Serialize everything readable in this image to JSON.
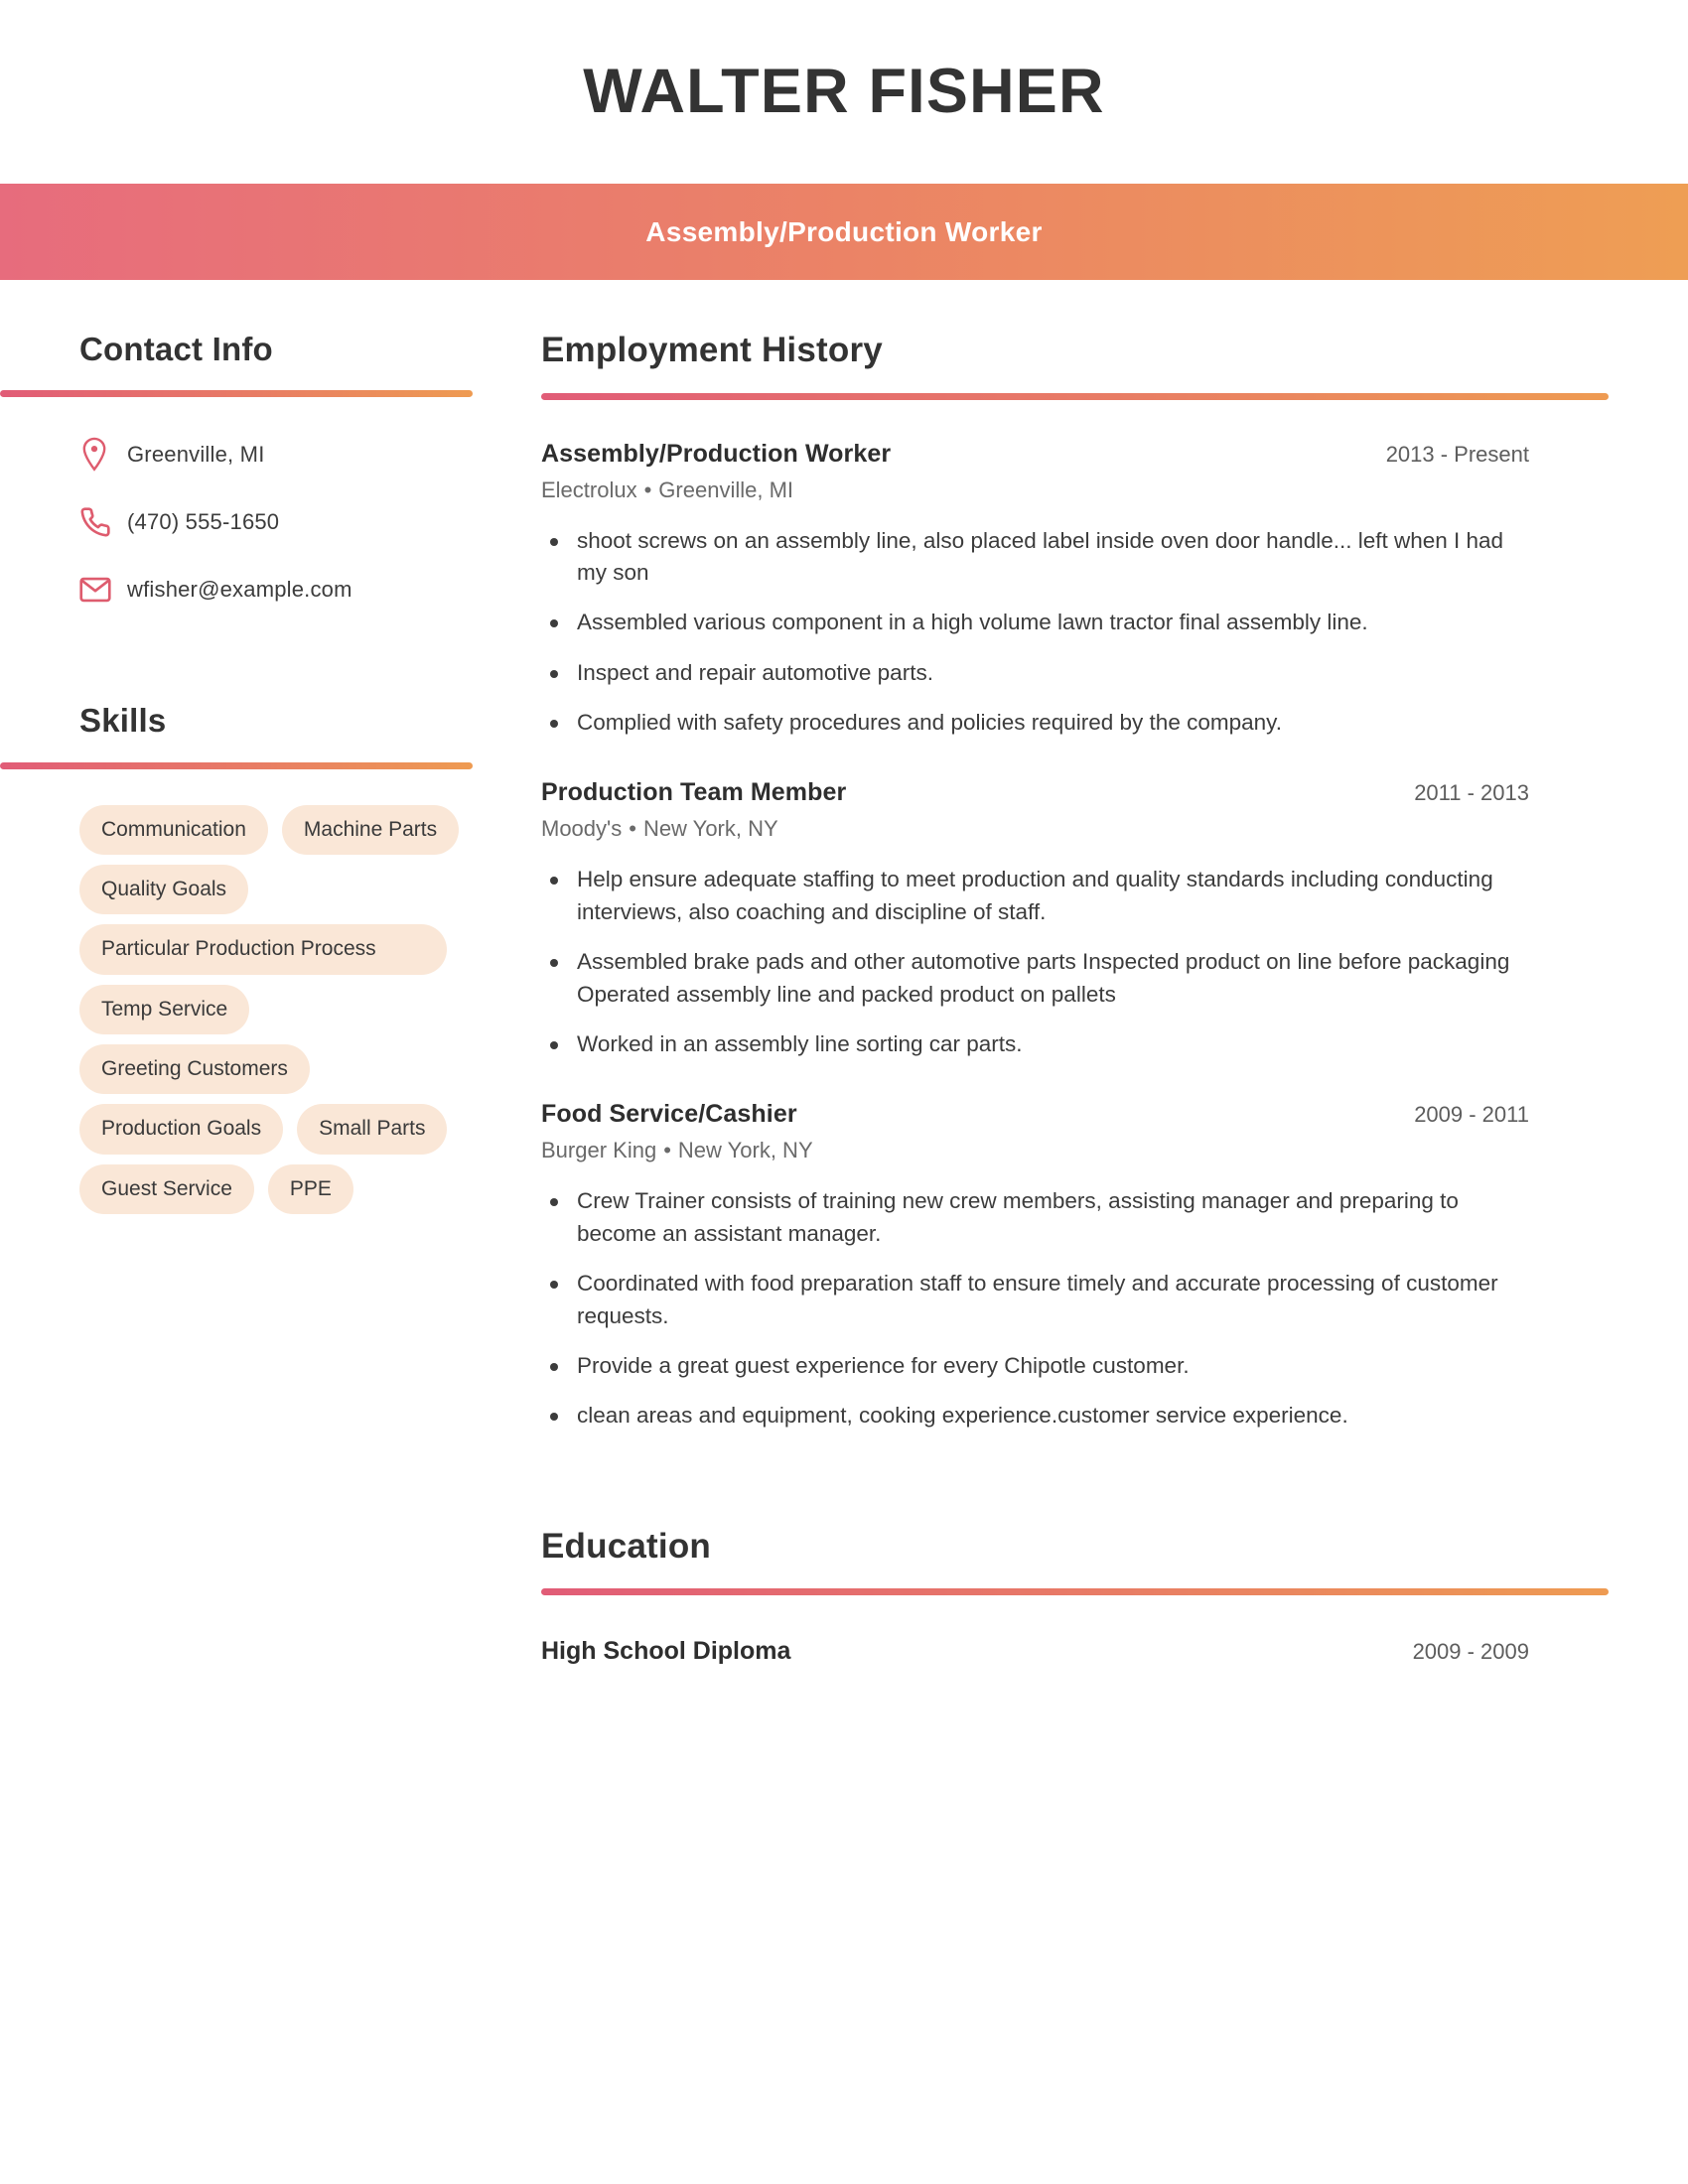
{
  "theme": {
    "gradient_start": "#E15C77",
    "gradient_mid": "#E87B65",
    "gradient_end": "#EE9B52",
    "icon_color": "#DE5C6E",
    "pill_bg": "#FAE7D7",
    "text_dark": "#333333",
    "text_muted": "#6a6a6a"
  },
  "header": {
    "name": "WALTER FISHER",
    "title": "Assembly/Production Worker"
  },
  "sidebar": {
    "contact": {
      "heading": "Contact Info",
      "items": [
        {
          "icon": "location-pin-icon",
          "value": "Greenville, MI"
        },
        {
          "icon": "phone-icon",
          "value": "(470) 555-1650"
        },
        {
          "icon": "envelope-icon",
          "value": "wfisher@example.com"
        }
      ]
    },
    "skills": {
      "heading": "Skills",
      "items": [
        "Communication",
        "Machine Parts",
        "Quality Goals",
        "Particular Production Process",
        "Temp Service",
        "Greeting Customers",
        "Production Goals",
        "Small Parts",
        "Guest Service",
        "PPE"
      ]
    }
  },
  "main": {
    "employment": {
      "heading": "Employment History",
      "jobs": [
        {
          "role": "Assembly/Production Worker",
          "dates": "2013 - Present",
          "company": "Electrolux",
          "location": "Greenville, MI",
          "bullets": [
            "shoot screws on an assembly line, also placed label inside oven door handle... left when I had my son",
            "Assembled various component in a high volume lawn tractor final assembly line.",
            "Inspect and repair automotive parts.",
            "Complied with safety procedures and policies required by the company."
          ]
        },
        {
          "role": "Production Team Member",
          "dates": "2011 - 2013",
          "company": "Moody's",
          "location": "New York, NY",
          "bullets": [
            "Help ensure adequate staffing to meet production and quality standards including conducting interviews, also coaching and discipline of staff.",
            "Assembled brake pads and other automotive parts Inspected product on line before packaging Operated assembly line and packed product on pallets",
            "Worked in an assembly line sorting car parts."
          ]
        },
        {
          "role": "Food Service/Cashier",
          "dates": "2009 - 2011",
          "company": "Burger King",
          "location": "New York, NY",
          "bullets": [
            "Crew Trainer consists of training new crew members, assisting manager and preparing to become an assistant manager.",
            "Coordinated with food preparation staff to ensure timely and accurate processing of customer requests.",
            "Provide a great guest experience for every Chipotle customer.",
            "clean areas and equipment, cooking experience.customer service experience."
          ]
        }
      ]
    },
    "education": {
      "heading": "Education",
      "entries": [
        {
          "degree": "High School Diploma",
          "dates": "2009 - 2009"
        }
      ]
    }
  }
}
